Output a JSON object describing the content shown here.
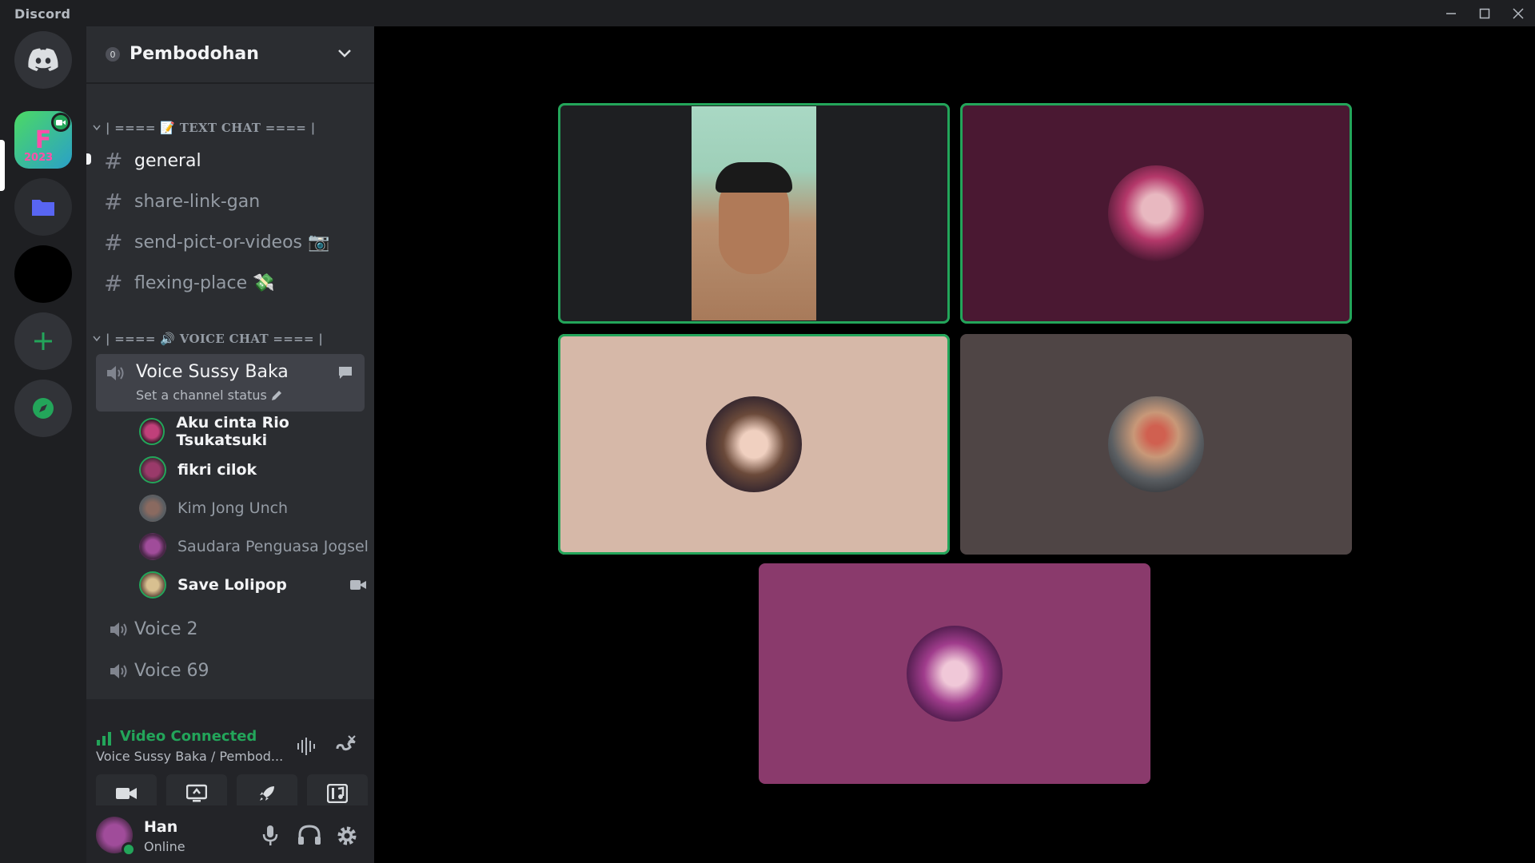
{
  "window": {
    "title": "Discord",
    "controls": [
      "minimize",
      "maximize",
      "close"
    ]
  },
  "server_rail": {
    "items": [
      {
        "name": "discord-home",
        "icon": "discord-logo-icon"
      },
      {
        "name": "server-fiesta-2023",
        "label": "F 2023",
        "active": true,
        "icon": "video-badge-icon"
      },
      {
        "name": "server-folder",
        "icon": "folder-icon"
      },
      {
        "name": "server-dark"
      },
      {
        "name": "add-server",
        "icon": "plus-icon"
      },
      {
        "name": "explore",
        "icon": "compass-icon"
      }
    ]
  },
  "guild": {
    "name": "Pembodohan",
    "boost_badge": "0"
  },
  "categories": {
    "text": "| ==== 📝 TEXT CHAT ==== |",
    "voice": "| ==== 🔊 VOICE CHAT ==== |"
  },
  "text_channels": [
    {
      "name": "general",
      "active": true
    },
    {
      "name": "share-link-gan"
    },
    {
      "name": "send-pict-or-videos 📷"
    },
    {
      "name": "flexing-place 💸"
    }
  ],
  "voice_channels": {
    "active": {
      "name": "Voice Sussy Baka",
      "status_placeholder": "Set a channel status"
    },
    "members": [
      {
        "name": "Aku cinta Rio Tsukatsuki",
        "speaking": true,
        "bright": true
      },
      {
        "name": "fikri cilok",
        "speaking": true,
        "bright": true
      },
      {
        "name": "Kim Jong Unch",
        "speaking": false,
        "bright": false
      },
      {
        "name": "Saudara Penguasa Jogsel",
        "speaking": false,
        "bright": false
      },
      {
        "name": "Save Lolipop",
        "speaking": true,
        "bright": true,
        "video": true
      }
    ],
    "others": [
      "Voice 2",
      "Voice 69"
    ]
  },
  "voice_panel": {
    "status": "Video Connected",
    "location": "Voice Sussy Baka / Pembod...",
    "buttons": [
      "camera",
      "screen-share",
      "activities",
      "soundboard"
    ]
  },
  "user": {
    "name": "Han",
    "status": "Online"
  },
  "tiles": [
    {
      "name": "tile-camera-feed",
      "bg": "#1e1f22",
      "speaking": true,
      "type": "camera"
    },
    {
      "name": "tile-avatar-1",
      "bg": "#4a1832",
      "speaking": true,
      "type": "avatar",
      "avatar_color": "#b4386a"
    },
    {
      "name": "tile-avatar-2",
      "bg": "#d6b8a8",
      "speaking": true,
      "type": "avatar",
      "avatar_color": "#6b4a3a"
    },
    {
      "name": "tile-avatar-3",
      "bg": "#4f4545",
      "speaking": false,
      "type": "avatar",
      "avatar_color": "#5a5e62"
    },
    {
      "name": "tile-avatar-4",
      "bg": "#8a3a6c",
      "speaking": false,
      "type": "avatar",
      "avatar_color": "#a03c8c"
    }
  ],
  "colors": {
    "accent_green": "#23a55a",
    "blurple": "#5865f2"
  }
}
